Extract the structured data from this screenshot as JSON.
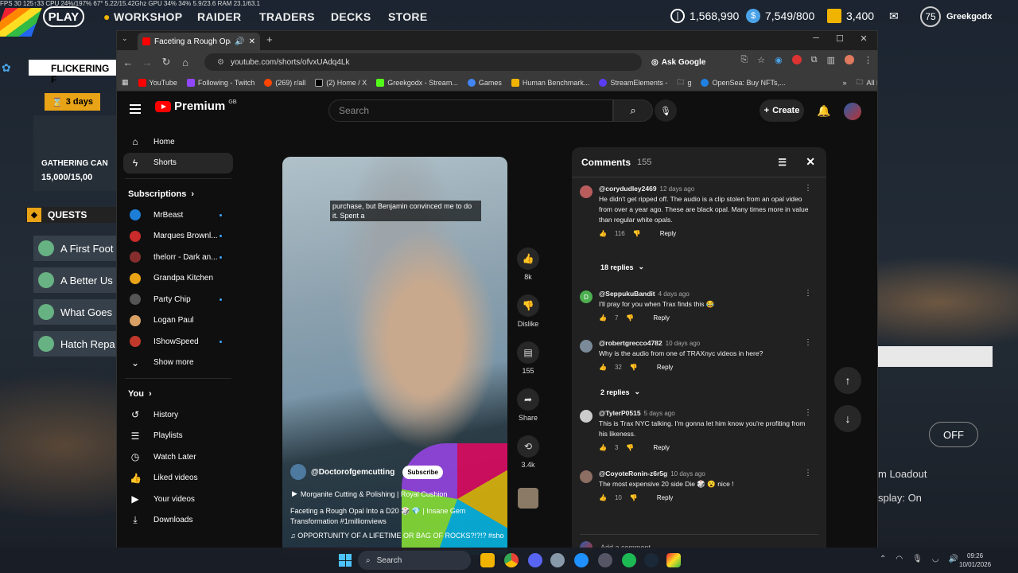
{
  "game": {
    "stats_bar": "FPS 30  125↑33  CPU 24%/197%  67°  5.22/15.42Ghz  GPU 34%  34%  5.9/23.6  RAM 23.1/63.1",
    "play_label": "PLAY",
    "nav": [
      "WORKSHOP",
      "RAIDER",
      "TRADERS",
      "DECKS",
      "STORE"
    ],
    "currencies": [
      {
        "value": "1,568,990",
        "icon": "coin-icon",
        "color": "#ffffff"
      },
      {
        "value": "7,549/800",
        "icon": "token-icon",
        "color": "#4aa3e8"
      },
      {
        "value": "3,400",
        "icon": "gold-bars-icon",
        "color": "#f0b400"
      }
    ],
    "level": "75",
    "username": "Greekgodx",
    "event_title": "FLICKERING F",
    "event_timer": "3 days",
    "gathering_title": "GATHERING CAN",
    "gathering_progress": "15,000/15,00",
    "quests_label": "QUESTS",
    "quests": [
      "A First Foot",
      "A Better Us",
      "What Goes",
      "Hatch Repa"
    ],
    "right_off": "OFF",
    "right_loadout": "m Loadout",
    "right_display": "splay: On"
  },
  "browser": {
    "tab_title": "Faceting a Rough Opal Into",
    "url": "youtube.com/shorts/ofvxUAdq4Lk",
    "ask_google": "Ask Google",
    "bookmarks": [
      "YouTube",
      "Following - Twitch",
      "(269) r/all",
      "(2) Home / X",
      "Greekgodx - Stream...",
      "Games",
      "Human Benchmark...",
      "StreamElements -",
      "g",
      "OpenSea: Buy NFTs,..."
    ],
    "all_bookmarks": "All Bookmarks"
  },
  "youtube": {
    "logo": "Premium",
    "logo_region": "GB",
    "search_placeholder": "Search",
    "create_label": "Create",
    "sidebar": {
      "home": "Home",
      "shorts": "Shorts",
      "subscriptions_heading": "Subscriptions",
      "subscriptions": [
        {
          "name": "MrBeast",
          "color": "#1c7ed6",
          "dot": true
        },
        {
          "name": "Marques Brownl...",
          "color": "#c92a2a",
          "dot": true
        },
        {
          "name": "thelorr - Dark an...",
          "color": "#862e2e",
          "dot": true
        },
        {
          "name": "Grandpa Kitchen",
          "color": "#e8a317",
          "dot": false
        },
        {
          "name": "Party Chip",
          "color": "#555555",
          "dot": true
        },
        {
          "name": "Logan Paul",
          "color": "#d9a066",
          "dot": false
        },
        {
          "name": "IShowSpeed",
          "color": "#c0392b",
          "dot": true
        }
      ],
      "show_more": "Show more",
      "you_heading": "You",
      "you_items": [
        {
          "label": "History",
          "icon": "history-icon",
          "glyph": "↺"
        },
        {
          "label": "Playlists",
          "icon": "playlists-icon",
          "glyph": "☰"
        },
        {
          "label": "Watch Later",
          "icon": "clock-icon",
          "glyph": "◷"
        },
        {
          "label": "Liked videos",
          "icon": "thumbs-up-icon",
          "glyph": "👍"
        },
        {
          "label": "Your videos",
          "icon": "your-videos-icon",
          "glyph": "▶"
        },
        {
          "label": "Downloads",
          "icon": "download-icon",
          "glyph": "⤓"
        }
      ]
    },
    "short": {
      "caption": "purchase, but Benjamin convinced me to do it. Spent a",
      "channel": "@Doctorofgemcutting",
      "subscribe": "Subscribe",
      "music": "Morganite Cutting & Polishing | Royal Cushion",
      "description": "Faceting a Rough Opal Into a D20 🎲 💎 | Insane Gem Transformation #1millionviews",
      "sound": "♫ OPPORTUNITY OF A LIFETIME OR BAG OF ROCKS?!?!? #sho",
      "progress": 0.95
    },
    "actions": {
      "likes": "8k",
      "dislike": "Dislike",
      "comments": "155",
      "share": "Share",
      "remix": "3.4k"
    },
    "comments_panel": {
      "title": "Comments",
      "count": "155",
      "add_placeholder": "Add a comment...",
      "reply_label": "Reply",
      "items": [
        {
          "author": "@corydudley2469",
          "date": "12 days ago",
          "text": "He didn't get ripped off. The audio is a clip stolen from an opal video from over a year ago. These are black opal. Many times more in value than regular white opals.",
          "likes": "116",
          "avatar_color": "#b85c5c",
          "replies": "18 replies"
        },
        {
          "author": "@SeppukuBandit",
          "date": "4 days ago",
          "text": "I'll pray for you when Trax finds this 😂",
          "likes": "7",
          "avatar_color": "#4caf50",
          "avatar_letter": "D",
          "replies": ""
        },
        {
          "author": "@robertgrecco4782",
          "date": "10 days ago",
          "text": "Why is the audio from one of TRAXnyc videos in here?",
          "likes": "32",
          "avatar_color": "#7b8a99",
          "replies": "2 replies"
        },
        {
          "author": "@TylerP0515",
          "date": "5 days ago",
          "text": "This is Trax NYC talking. I'm gonna let him know you're profiting from his likeness.",
          "likes": "3",
          "avatar_color": "#cccccc",
          "replies": ""
        },
        {
          "author": "@CoyoteRonin-z6r5g",
          "date": "10 days ago",
          "text": "The most expensive 20 side Die 🎲 😮 nice !",
          "likes": "10",
          "avatar_color": "#8d6e63",
          "replies": ""
        }
      ]
    }
  },
  "taskbar": {
    "search": "Search",
    "time": "09:26",
    "date": "10/01/2026"
  }
}
